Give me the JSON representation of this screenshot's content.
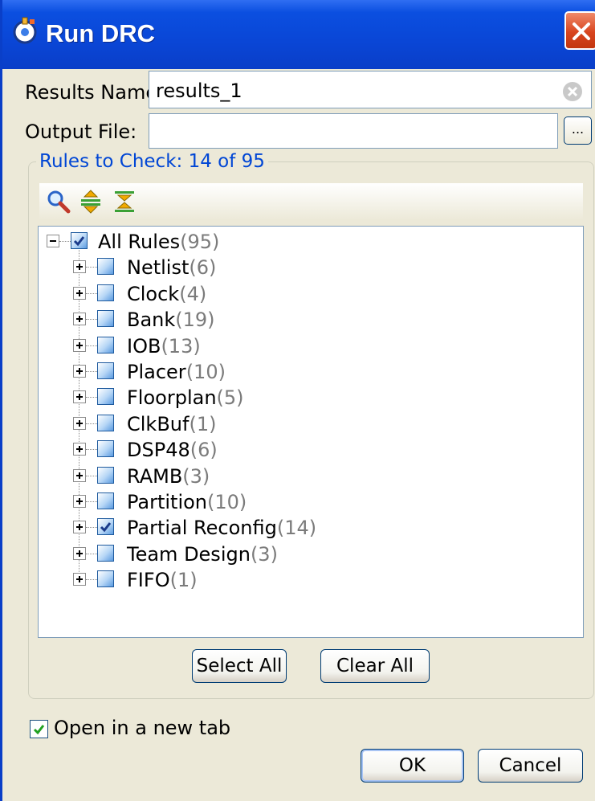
{
  "window": {
    "title": "Run DRC",
    "title_bar_color": "#0a46d6",
    "close_button_color": "#d8451f",
    "app_icon": "drc-app-icon",
    "close_icon": "close-icon"
  },
  "form": {
    "results_name_label": "Results Name:",
    "results_name_value": "results_1",
    "output_file_label": "Output File:",
    "output_file_value": "",
    "browse_label": "..."
  },
  "rules": {
    "group_title": "Rules to Check: 14 of 95",
    "group_title_color": "#0046d5",
    "toolbar_icons": [
      "search-icon",
      "expand-all-icon",
      "collapse-all-icon"
    ],
    "root": {
      "label": "All Rules",
      "count": "(95)",
      "checked": true,
      "expanded": true
    },
    "items": [
      {
        "label": "Netlist",
        "count": "(6)",
        "checked": false
      },
      {
        "label": "Clock",
        "count": "(4)",
        "checked": false
      },
      {
        "label": "Bank",
        "count": "(19)",
        "checked": false
      },
      {
        "label": "IOB",
        "count": "(13)",
        "checked": false
      },
      {
        "label": "Placer",
        "count": "(10)",
        "checked": false
      },
      {
        "label": "Floorplan",
        "count": "(5)",
        "checked": false
      },
      {
        "label": "ClkBuf",
        "count": "(1)",
        "checked": false
      },
      {
        "label": "DSP48",
        "count": "(6)",
        "checked": false
      },
      {
        "label": "RAMB",
        "count": "(3)",
        "checked": false
      },
      {
        "label": "Partition",
        "count": "(10)",
        "checked": false
      },
      {
        "label": "Partial Reconfig",
        "count": "(14)",
        "checked": true
      },
      {
        "label": "Team Design",
        "count": "(3)",
        "checked": false
      },
      {
        "label": "FIFO",
        "count": "(1)",
        "checked": false
      }
    ],
    "select_all_label": "Select All",
    "clear_all_label": "Clear All"
  },
  "footer": {
    "open_new_tab_label": "Open in a new tab",
    "open_new_tab_checked": true,
    "ok_label": "OK",
    "cancel_label": "Cancel"
  }
}
